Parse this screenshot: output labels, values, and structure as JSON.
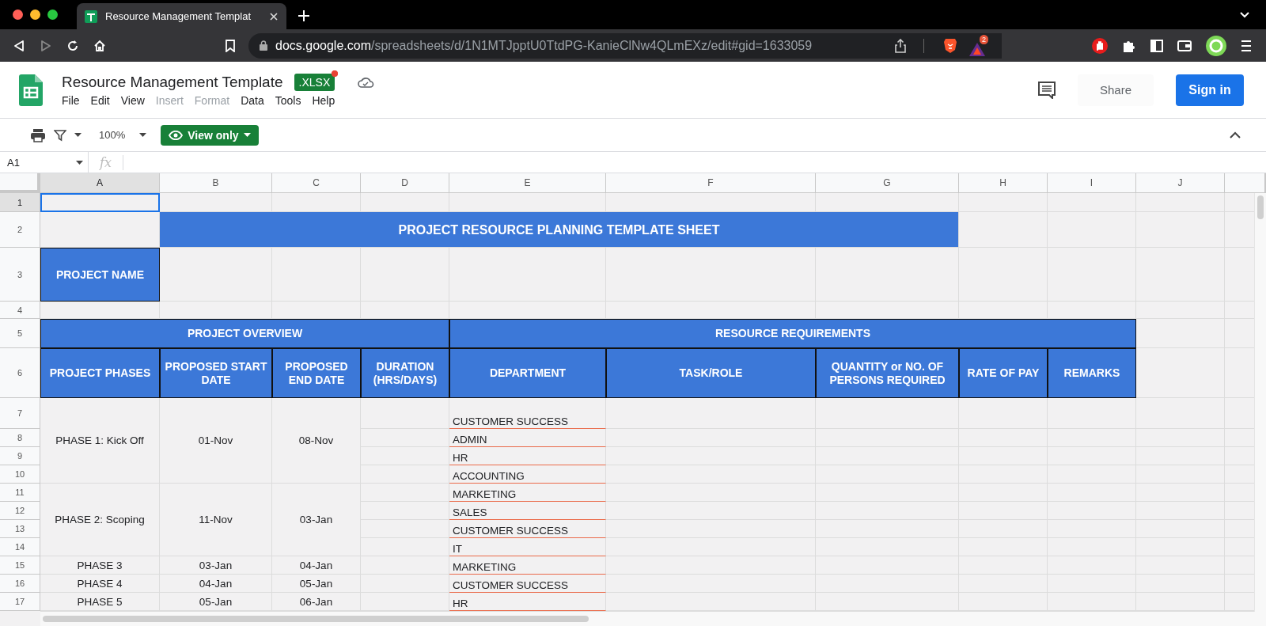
{
  "browser": {
    "tab_title": "Resource Management Templat",
    "url_host": "docs.google.com",
    "url_path": "/spreadsheets/d/1N1MTJpptU0TtdPG-KanieClNw4QLmEXz/edit#gid=1633059",
    "extension_badge": "2"
  },
  "doc": {
    "title": "Resource Management Template",
    "format_badge": ".XLSX"
  },
  "menu": [
    {
      "label": "File",
      "disabled": false
    },
    {
      "label": "Edit",
      "disabled": false
    },
    {
      "label": "View",
      "disabled": false
    },
    {
      "label": "Insert",
      "disabled": true
    },
    {
      "label": "Format",
      "disabled": true
    },
    {
      "label": "Data",
      "disabled": false
    },
    {
      "label": "Tools",
      "disabled": false
    },
    {
      "label": "Help",
      "disabled": false
    }
  ],
  "share_button": "Share",
  "sign_in_button": "Sign in",
  "toolbar": {
    "zoom": "100%",
    "mode_button": "View only"
  },
  "formula_bar": {
    "name_box": "A1",
    "function_label": "fx"
  },
  "sheet": {
    "columns": [
      {
        "label": "A",
        "selected": true
      },
      {
        "label": "B",
        "selected": false
      },
      {
        "label": "C",
        "selected": false
      },
      {
        "label": "D",
        "selected": false
      },
      {
        "label": "E",
        "selected": false
      },
      {
        "label": "F",
        "selected": false
      },
      {
        "label": "G",
        "selected": false
      },
      {
        "label": "H",
        "selected": false
      },
      {
        "label": "I",
        "selected": false
      },
      {
        "label": "J",
        "selected": false
      }
    ],
    "row_numbers": [
      {
        "label": "1",
        "selected": true
      },
      {
        "label": "2",
        "selected": false
      },
      {
        "label": "3",
        "selected": false
      },
      {
        "label": "4",
        "selected": false
      },
      {
        "label": "5",
        "selected": false
      },
      {
        "label": "6",
        "selected": false
      },
      {
        "label": "7",
        "selected": false
      },
      {
        "label": "8",
        "selected": false
      },
      {
        "label": "9",
        "selected": false
      },
      {
        "label": "10",
        "selected": false
      },
      {
        "label": "11",
        "selected": false
      },
      {
        "label": "12",
        "selected": false
      },
      {
        "label": "13",
        "selected": false
      },
      {
        "label": "14",
        "selected": false
      },
      {
        "label": "15",
        "selected": false
      },
      {
        "label": "16",
        "selected": false
      },
      {
        "label": "17",
        "selected": false
      }
    ],
    "title": "PROJECT RESOURCE PLANNING TEMPLATE SHEET",
    "project_name_label": "PROJECT NAME",
    "section_headers": [
      "PROJECT OVERVIEW",
      "RESOURCE REQUIREMENTS"
    ],
    "table_columns": [
      "PROJECT PHASES",
      "PROPOSED START DATE",
      "PROPOSED END DATE",
      "DURATION (HRS/DAYS)",
      "DEPARTMENT",
      "TASK/ROLE",
      "QUANTITY or NO. OF PERSONS REQUIRED",
      "RATE OF PAY",
      "REMARKS"
    ],
    "phases": [
      {
        "phase": "PHASE 1: Kick Off",
        "start": "01-Nov",
        "end": "08-Nov",
        "departments": [
          "CUSTOMER SUCCESS",
          "ADMIN",
          "HR",
          "ACCOUNTING"
        ]
      },
      {
        "phase": "PHASE 2: Scoping",
        "start": "11-Nov",
        "end": "03-Jan",
        "departments": [
          "MARKETING",
          "SALES",
          "CUSTOMER SUCCESS",
          "IT"
        ]
      },
      {
        "phase": "PHASE 3",
        "start": "03-Jan",
        "end": "04-Jan",
        "departments": [
          "MARKETING"
        ]
      },
      {
        "phase": "PHASE 4",
        "start": "04-Jan",
        "end": "05-Jan",
        "departments": [
          "CUSTOMER SUCCESS"
        ]
      },
      {
        "phase": "PHASE 5",
        "start": "05-Jan",
        "end": "06-Jan",
        "departments": [
          "HR"
        ]
      }
    ]
  }
}
